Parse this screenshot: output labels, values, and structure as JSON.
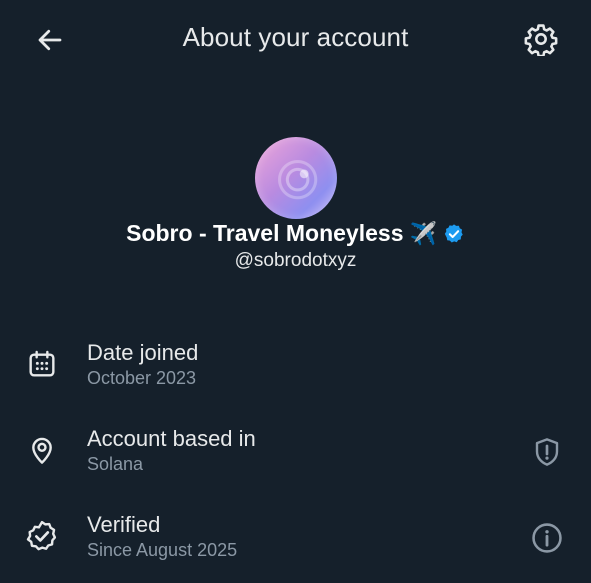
{
  "header": {
    "title": "About your account",
    "back_icon": "arrow-left-icon",
    "settings_icon": "gear-icon"
  },
  "profile": {
    "display_name": "Sobro - Travel Moneyless",
    "emoji": "✈️",
    "handle": "@sobrodotxyz",
    "verified_color": "#1d9bf0"
  },
  "rows": [
    {
      "title": "Date joined",
      "subtitle": "October 2023",
      "icon": "calendar-icon"
    },
    {
      "title": "Account based in",
      "subtitle": "Solana",
      "icon": "location-pin-icon",
      "action_icon": "shield-alert-icon"
    },
    {
      "title": "Verified",
      "subtitle": "Since August 2025",
      "icon": "verified-check-icon",
      "action_icon": "info-icon"
    }
  ],
  "colors": {
    "background": "#15202b",
    "text_primary": "#e7e9ea",
    "text_secondary": "#8b98a5",
    "accent": "#1d9bf0"
  }
}
